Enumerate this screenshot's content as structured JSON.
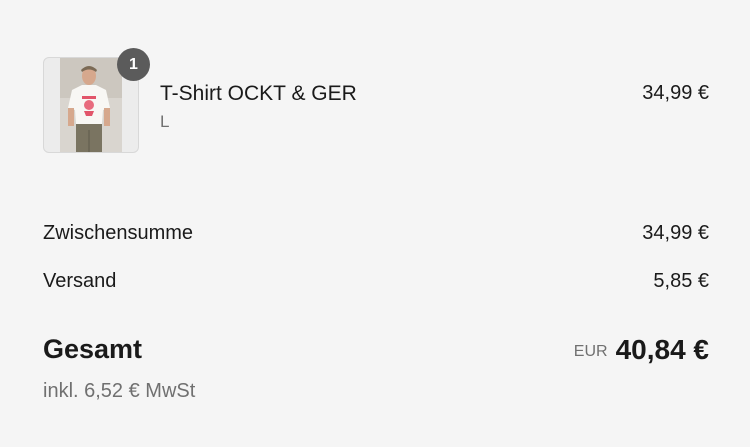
{
  "cart": {
    "items": [
      {
        "quantity": "1",
        "title": "T-Shirt OCKT & GER",
        "variant": "L",
        "price": "34,99 €",
        "image_icon": "product-photo-tshirt"
      }
    ]
  },
  "totals": {
    "subtotal_label": "Zwischensumme",
    "subtotal_value": "34,99 €",
    "shipping_label": "Versand",
    "shipping_value": "5,85 €",
    "total_label": "Gesamt",
    "currency_code": "EUR",
    "total_value": "40,84 €",
    "tax_note": "inkl. 6,52 € MwSt"
  },
  "colors": {
    "background": "#f5f5f5",
    "badge": "#5b5b5b",
    "text": "#1a1a1a",
    "muted": "#707070"
  }
}
